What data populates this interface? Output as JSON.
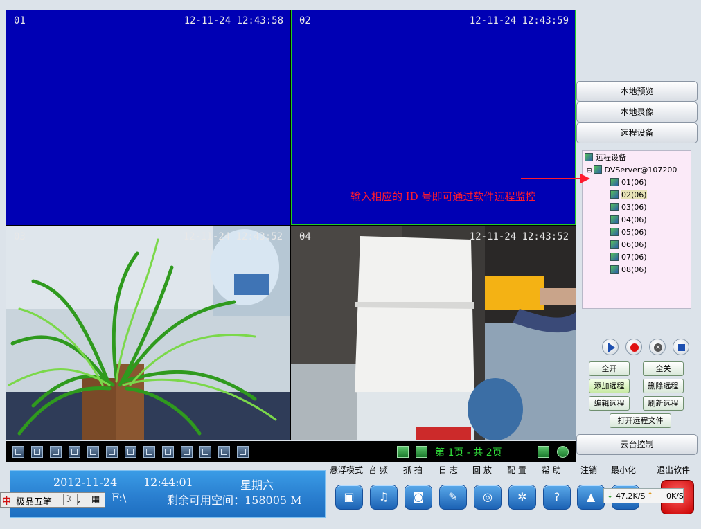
{
  "video": {
    "tiles": [
      {
        "channel": "01",
        "timestamp": "12-11-24  12:43:58"
      },
      {
        "channel": "02",
        "timestamp": "12-11-24  12:43:59"
      },
      {
        "channel": "03",
        "timestamp": "12-11-24  12:43:52"
      },
      {
        "channel": "04",
        "timestamp": "12-11-24  12:43:52"
      }
    ],
    "annotation": "输入相应的 ID 号即可通过软件远程监控"
  },
  "layout_bar": {
    "buttons": [
      "1",
      "4",
      "6",
      "8",
      "9",
      "10",
      "13",
      "16",
      "25",
      "36",
      "49",
      "64",
      "F"
    ],
    "page_info": "第 1页 - 共 2页"
  },
  "side": {
    "local_preview": "本地预览",
    "local_record": "本地录像",
    "remote_device": "远程设备",
    "tree": {
      "root": "远程设备",
      "server": "DVServer@107200",
      "channels": [
        "01(06)",
        "02(06)",
        "03(06)",
        "04(06)",
        "05(06)",
        "06(06)",
        "07(06)",
        "08(06)"
      ]
    },
    "open_all": "全开",
    "close_all": "全关",
    "add_remote": "添加远程",
    "delete_remote": "删除远程",
    "edit_remote": "编辑远程",
    "refresh_remote": "刷新远程",
    "open_remote_file": "打开远程文件",
    "ptz_control": "云台控制"
  },
  "menu": {
    "float_mode": "悬浮模式",
    "audio": "音 频",
    "snapshot": "抓 拍",
    "log": "日 志",
    "playback": "回 放",
    "config": "配 置",
    "help": "帮 助",
    "logout": "注销",
    "minimize": "最小化",
    "exit": "退出软件"
  },
  "clock": {
    "date": "2012-11-24",
    "time": "12:44:01",
    "weekday": "星期六",
    "drive": "F:\\",
    "free_space": "剩余可用空间：158005 M"
  },
  "ime": {
    "logo": "中",
    "name": "极品五笔"
  },
  "net": {
    "down": "47.2K/S",
    "up": "0K/S"
  },
  "colors": {
    "video_blue": "#0000b4",
    "annotation": "#ff1a2e",
    "page_green": "#31e23b"
  }
}
